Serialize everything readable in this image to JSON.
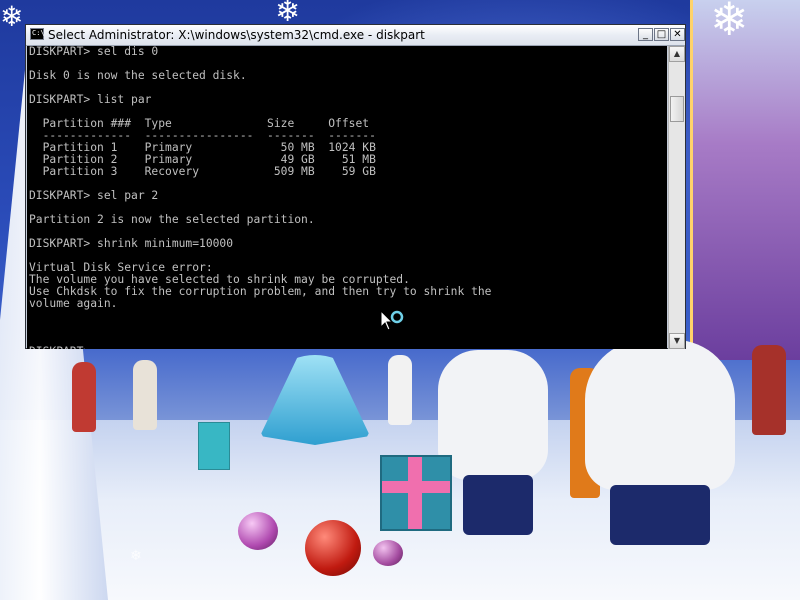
{
  "window": {
    "title": "Select Administrator: X:\\windows\\system32\\cmd.exe - diskpart",
    "icon_glyph": "C:\\",
    "minimize_glyph": "_",
    "maximize_glyph": "□",
    "close_glyph": "✕"
  },
  "console": {
    "text": "DISKPART> sel dis 0\n\nDisk 0 is now the selected disk.\n\nDISKPART> list par\n\n  Partition ###  Type              Size     Offset\n  -------------  ----------------  -------  -------\n  Partition 1    Primary             50 MB  1024 KB\n  Partition 2    Primary             49 GB    51 MB\n  Partition 3    Recovery           509 MB    59 GB\n\nDISKPART> sel par 2\n\nPartition 2 is now the selected partition.\n\nDISKPART> shrink minimum=10000\n\nVirtual Disk Service error:\nThe volume you have selected to shrink may be corrupted.\nUse Chkdsk to fix the corruption problem, and then try to shrink the\nvolume again.\n\n\n\nDISKPART> ",
    "text_color": "#c0c0c0",
    "background": "#000000"
  },
  "scrollbar": {
    "up_glyph": "▲",
    "down_glyph": "▼"
  },
  "colors": {
    "desktop_sky": "#2a4bb8",
    "snow": "#e8eef9",
    "title_bar": "#e9edf4"
  }
}
